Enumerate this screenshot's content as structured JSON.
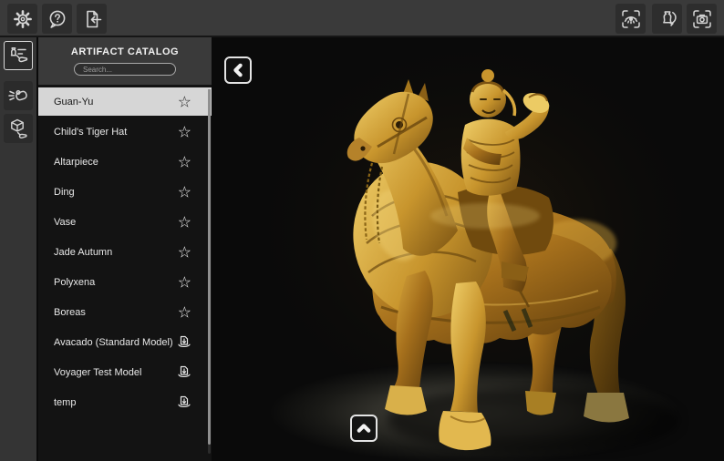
{
  "topbar": {
    "left_buttons": [
      {
        "id": "settings",
        "icon": "gear-icon"
      },
      {
        "id": "help",
        "icon": "help-bubble-icon"
      },
      {
        "id": "import-model",
        "icon": "import-model-icon"
      }
    ],
    "right_buttons": [
      {
        "id": "focus-view",
        "icon": "eye-focus-icon"
      },
      {
        "id": "rotate-model",
        "icon": "rotate-artifact-icon"
      },
      {
        "id": "screenshot",
        "icon": "camera-capture-icon"
      }
    ]
  },
  "toolrail": {
    "tools": [
      {
        "id": "artifact-catalog",
        "icon": "vase-list-hand-icon",
        "active": true
      },
      {
        "id": "flashlight",
        "icon": "flashlight-hand-icon",
        "active": false
      },
      {
        "id": "grab-object",
        "icon": "cube-hand-icon",
        "active": false
      }
    ]
  },
  "catalog": {
    "title": "ARTIFACT CATALOG",
    "search": {
      "placeholder": "Search...",
      "value": ""
    },
    "items": [
      {
        "label": "Guan-Yu",
        "action_icon": "star",
        "selected": true
      },
      {
        "label": "Child's Tiger Hat",
        "action_icon": "star",
        "selected": false
      },
      {
        "label": "Altarpiece",
        "action_icon": "star",
        "selected": false
      },
      {
        "label": "Ding",
        "action_icon": "star",
        "selected": false
      },
      {
        "label": "Vase",
        "action_icon": "star",
        "selected": false
      },
      {
        "label": "Jade Autumn",
        "action_icon": "star",
        "selected": false
      },
      {
        "label": "Polyxena",
        "action_icon": "star",
        "selected": false
      },
      {
        "label": "Boreas",
        "action_icon": "star",
        "selected": false
      },
      {
        "label": "Avacado (Standard Model)",
        "action_icon": "file-download",
        "selected": false
      },
      {
        "label": "Voyager Test Model",
        "action_icon": "file-download",
        "selected": false
      },
      {
        "label": "temp",
        "action_icon": "file-download",
        "selected": false
      }
    ]
  },
  "glyphs": {
    "star": "☆"
  },
  "viewport": {
    "model": "Gilded bronze equestrian statue (Guan-Yu on armored horse)",
    "back_button_icon": "chevron-left-icon",
    "bottom_button_icon": "chevron-up-icon"
  },
  "colors": {
    "topbar": "#3a3a3a",
    "panel_header": "#3a3a3a",
    "list_background": "#131313",
    "selected_row": "#d6d6d6",
    "viewport_background": "#0a0a0a",
    "gold": "#c89b3c",
    "floor_spot": "#45443c"
  }
}
